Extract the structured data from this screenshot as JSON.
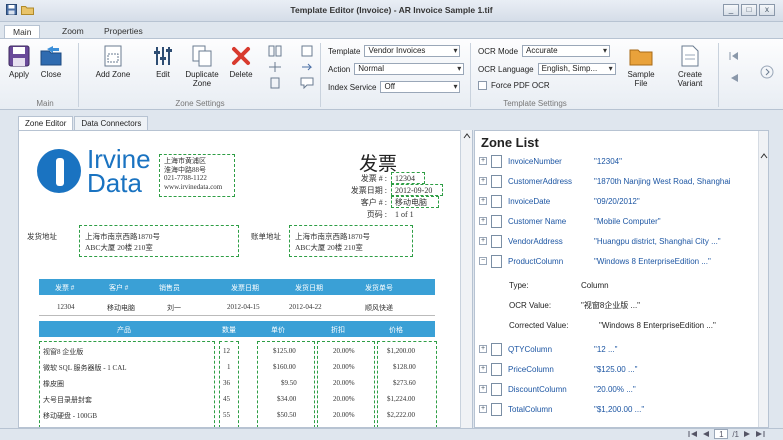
{
  "window": {
    "title": "Template Editor (Invoice) - AR Invoice Sample 1.tif",
    "controls": [
      "_",
      "□",
      "x"
    ]
  },
  "menu_tabs": [
    {
      "label": "Main",
      "active": true
    },
    {
      "label": "Zoom",
      "active": false
    },
    {
      "label": "Properties",
      "active": false
    }
  ],
  "ribbon": {
    "apply_label": "Apply",
    "close_label": "Close",
    "add_zone_label": "Add Zone",
    "edit_label": "Edit",
    "duplicate_label": "Duplicate Zone",
    "delete_label": "Delete",
    "sample_file_label": "Sample File",
    "create_variant_label": "Create Variant",
    "group_main": "Main",
    "group_zone_settings": "Zone Settings",
    "group_template_settings": "Template Settings",
    "template_label": "Template",
    "template_value": "Vendor Invoices",
    "action_label": "Action",
    "action_value": "Normal",
    "index_service_label": "Index Service",
    "index_service_value": "Off",
    "ocr_mode_label": "OCR Mode",
    "ocr_mode_value": "Accurate",
    "ocr_language_label": "OCR Language",
    "ocr_language_value": "English, Simp...",
    "force_pdf_ocr_label": "Force PDF OCR"
  },
  "doc_tabs": [
    {
      "label": "Zone Editor",
      "active": true
    },
    {
      "label": "Data Connectors",
      "active": false
    }
  ],
  "invoice": {
    "logo_line1": "Irvine",
    "logo_line2": "Data",
    "address_lines": [
      "上海市黄浦区",
      "淮海中路88号",
      "021-7788-1122",
      "www.irvinedata.com"
    ],
    "title": "发票",
    "number_label": "发票 # :",
    "number_value": "12304",
    "date_label": "发票日期 :",
    "date_value": "2012-09-20",
    "customer_label": "客户 # :",
    "customer_value": "移动电脑",
    "page_label": "页码 :",
    "page_value": "1 of 1",
    "bill_label": "发货地址",
    "bill_lines": [
      "上海市南京西路1870号",
      "ABC大厦 20楼 210室"
    ],
    "ship_label": "账单地址",
    "ship_lines": [
      "上海市南京西路1870号",
      "ABC大厦 20楼 210室"
    ],
    "header1": [
      "发票 #",
      "客户 #",
      "销售员",
      "发票日期",
      "发货日期",
      "发货单号"
    ],
    "row1": [
      "12304",
      "移动电脑",
      "刘一",
      "2012-04-15",
      "2012-04-22",
      "顺风快递"
    ],
    "header2": [
      "产品",
      "数量",
      "单价",
      "折扣",
      "价格"
    ],
    "products": [
      "视窗8 企业版",
      "微软 SQL 服务器版 - 1 CAL",
      "橡皮圈",
      "大号目录册封套",
      "移动硬盘 - 100GB"
    ],
    "qty": [
      "12",
      "1",
      "36",
      "45",
      "55"
    ],
    "price": [
      "$125.00",
      "$160.00",
      "$9.50",
      "$34.00",
      "$50.50"
    ],
    "discount": [
      "20.00%",
      "20.00%",
      "20.00%",
      "20.00%",
      "20.00%"
    ],
    "total": [
      "$1,200.00",
      "$128.00",
      "$273.60",
      "$1,224.00",
      "$2,222.00"
    ]
  },
  "zone_list": {
    "title": "Zone List",
    "items": [
      {
        "name": "InvoiceNumber",
        "value": "\"12304\""
      },
      {
        "name": "CustomerAddress",
        "value": "\"1870th Nanjing West Road, Shanghai"
      },
      {
        "name": "InvoiceDate",
        "value": "\"09/20/2012\""
      },
      {
        "name": "Customer Name",
        "value": "\"Mobile Computer\""
      },
      {
        "name": "VendorAddress",
        "value": "\"Huangpu district, Shanghai City ...\""
      },
      {
        "name": "ProductColumn",
        "value": "\"Windows 8 EnterpriseEdition ...\""
      }
    ],
    "sub_items": [
      {
        "name": "Type:",
        "value": "Column"
      },
      {
        "name": "OCR Value:",
        "value": "\"视窗8企业版 ...\""
      },
      {
        "name": "Corrected Value:",
        "value": "\"Windows 8 EnterpriseEdition ...\""
      }
    ],
    "items2": [
      {
        "name": "QTYColumn",
        "value": "\"12 ...\""
      },
      {
        "name": "PriceColumn",
        "value": "\"$125.00 ...\""
      },
      {
        "name": "DiscountColumn",
        "value": "\"20.00% ...\""
      },
      {
        "name": "TotalColumn",
        "value": "\"$1,200.00 ...\""
      }
    ]
  },
  "pager": {
    "current": "1",
    "total": "/1"
  },
  "colors": {
    "accent": "#1a73c1",
    "zone": "#2e9e45",
    "table_header": "#3aa0d6",
    "delete": "#d83a2e"
  }
}
